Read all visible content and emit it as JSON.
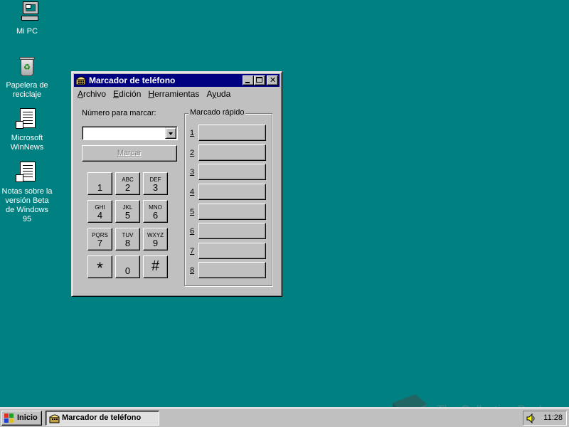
{
  "desktop": {
    "icons": [
      {
        "label": "Mi PC",
        "icon": "my-computer-icon"
      },
      {
        "label": "Papelera de reciclaje",
        "icon": "recycle-bin-icon"
      },
      {
        "label": "Microsoft WinNews",
        "icon": "document-shortcut-icon"
      },
      {
        "label": "Notas sobre la versión Beta de Windows 95",
        "icon": "document-shortcut-icon"
      }
    ]
  },
  "window": {
    "title": "Marcador de teléfono",
    "menu": [
      {
        "label": "Archivo",
        "accel": "A"
      },
      {
        "label": "Edición",
        "accel": "E"
      },
      {
        "label": "Herramientas",
        "accel": "H"
      },
      {
        "label": "Ayuda",
        "accel": "y"
      }
    ],
    "number_label": "Número para marcar:",
    "number_value": "",
    "dial_button": "Marcar",
    "keypad": [
      {
        "digit": "1",
        "letters": ""
      },
      {
        "digit": "2",
        "letters": "ABC"
      },
      {
        "digit": "3",
        "letters": "DEF"
      },
      {
        "digit": "4",
        "letters": "GHI"
      },
      {
        "digit": "5",
        "letters": "JKL"
      },
      {
        "digit": "6",
        "letters": "MNO"
      },
      {
        "digit": "7",
        "letters": "PQRS"
      },
      {
        "digit": "8",
        "letters": "TUV"
      },
      {
        "digit": "9",
        "letters": "WXYZ"
      },
      {
        "digit": "*",
        "letters": ""
      },
      {
        "digit": "0",
        "letters": ""
      },
      {
        "digit": "#",
        "letters": ""
      }
    ],
    "speed_dial": {
      "title": "Marcado rápido",
      "slots": [
        "1",
        "2",
        "3",
        "4",
        "5",
        "6",
        "7",
        "8"
      ]
    }
  },
  "taskbar": {
    "start_label": "Inicio",
    "task_label": "Marcador de teléfono",
    "clock": "11:28"
  },
  "watermark": {
    "text": "The Collection Book"
  },
  "colors": {
    "desktop": "#008080",
    "titlebar": "#000080",
    "face": "#c0c0c0"
  }
}
